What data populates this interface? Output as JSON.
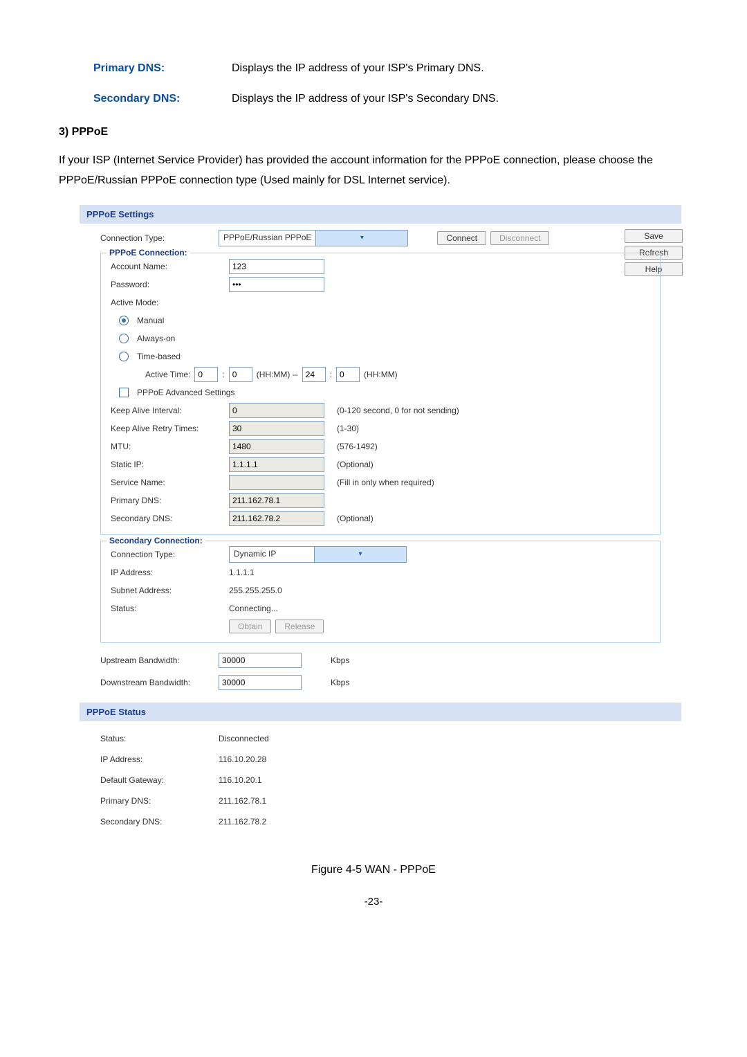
{
  "definitions": {
    "primary_dns": {
      "label": "Primary DNS:",
      "desc": "Displays the IP address of your ISP's Primary DNS."
    },
    "secondary_dns": {
      "label": "Secondary DNS:",
      "desc": "Displays the IP address of your ISP's Secondary DNS."
    }
  },
  "section_heading": "3)   PPPoE",
  "intro_para": "If your ISP (Internet Service Provider) has provided the account information for the PPPoE connection, please choose the PPPoE/Russian PPPoE connection type (Used mainly for DSL Internet service).",
  "settings": {
    "header": "PPPoE Settings",
    "connection_type_label": "Connection Type:",
    "connection_type_value": "PPPoE/Russian PPPoE",
    "connect_btn": "Connect",
    "disconnect_btn": "Disconnect",
    "side": {
      "save": "Save",
      "refresh": "Refresh",
      "help": "Help"
    },
    "pppoe_conn": {
      "legend": "PPPoE Connection:",
      "account_label": "Account Name:",
      "account_value": "123",
      "password_label": "Password:",
      "password_value": "•••",
      "active_mode_label": "Active Mode:",
      "manual_label": "Manual",
      "always_on_label": "Always-on",
      "time_based_label": "Time-based",
      "active_time_label": "Active Time:",
      "at_h1": "0",
      "at_m1": "0",
      "at_mid": "(HH:MM) --",
      "at_h2": "24",
      "at_m2": "0",
      "at_suffix": "(HH:MM)",
      "adv_label": "PPPoE Advanced Settings",
      "keep_alive_interval_label": "Keep Alive Interval:",
      "keep_alive_interval_value": "0",
      "keep_alive_interval_hint": "(0-120 second, 0 for not sending)",
      "keep_alive_retry_label": "Keep Alive Retry Times:",
      "keep_alive_retry_value": "30",
      "keep_alive_retry_hint": "(1-30)",
      "mtu_label": "MTU:",
      "mtu_value": "1480",
      "mtu_hint": "(576-1492)",
      "static_ip_label": "Static IP:",
      "static_ip_value": "1.1.1.1",
      "static_ip_hint": "(Optional)",
      "service_name_label": "Service Name:",
      "service_name_value": "",
      "service_name_hint": "(Fill in only when required)",
      "primary_dns_label": "Primary DNS:",
      "primary_dns_value": "211.162.78.1",
      "secondary_dns_label": "Secondary DNS:",
      "secondary_dns_value": "211.162.78.2",
      "secondary_dns_hint": "(Optional)"
    },
    "secondary_conn": {
      "legend": "Secondary Connection:",
      "conn_type_label": "Connection Type:",
      "conn_type_value": "Dynamic IP",
      "ip_label": "IP Address:",
      "ip_value": "1.1.1.1",
      "subnet_label": "Subnet Address:",
      "subnet_value": "255.255.255.0",
      "status_label": "Status:",
      "status_value": "Connecting...",
      "obtain_btn": "Obtain",
      "release_btn": "Release"
    },
    "upstream_label": "Upstream Bandwidth:",
    "upstream_value": "30000",
    "downstream_label": "Downstream Bandwidth:",
    "downstream_value": "30000",
    "bw_unit": "Kbps"
  },
  "status": {
    "header": "PPPoE Status",
    "status_label": "Status:",
    "status_value": "Disconnected",
    "ip_label": "IP Address:",
    "ip_value": "116.10.20.28",
    "gateway_label": "Default Gateway:",
    "gateway_value": "116.10.20.1",
    "pdns_label": "Primary DNS:",
    "pdns_value": "211.162.78.1",
    "sdns_label": "Secondary DNS:",
    "sdns_value": "211.162.78.2"
  },
  "figure_caption": "Figure 4-5 WAN - PPPoE",
  "page_number": "-23-"
}
